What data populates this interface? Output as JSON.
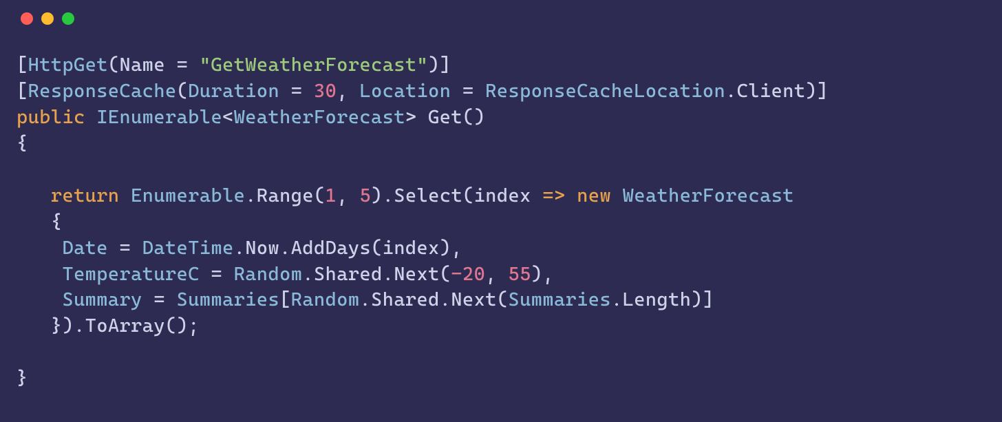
{
  "code": {
    "tokens": {
      "bracket_open": "[",
      "bracket_close": "]",
      "paren_open": "(",
      "paren_close": ")",
      "brace_open": "{",
      "brace_close": "}",
      "angle_open": "<",
      "angle_close": ">",
      "eq": "=",
      "comma": ",",
      "dot": ".",
      "semicolon": ";",
      "arrow": "=>",
      "minus": "-"
    },
    "attr_HttpGet": "HttpGet",
    "param_Name": "Name",
    "str_route": "\"GetWeatherForecast\"",
    "attr_ResponseCache": "ResponseCache",
    "param_Duration": "Duration",
    "num_30": "30",
    "param_Location": "Location",
    "ident_ResponseCacheLocation": "ResponseCacheLocation",
    "ident_Client": "Client",
    "kw_public": "public",
    "type_IEnumerable": "IEnumerable",
    "type_WeatherForecast": "WeatherForecast",
    "method_Get": "Get",
    "kw_return": "return",
    "ident_Enumerable": "Enumerable",
    "method_Range": "Range",
    "num_1": "1",
    "num_5": "5",
    "method_Select": "Select",
    "ident_index": "index",
    "kw_new": "new",
    "prop_Date": "Date",
    "ident_DateTime": "DateTime",
    "ident_Now": "Now",
    "method_AddDays": "AddDays",
    "prop_TemperatureC": "TemperatureC",
    "ident_Random": "Random",
    "ident_Shared": "Shared",
    "method_Next": "Next",
    "num_20": "20",
    "num_55": "55",
    "prop_Summary": "Summary",
    "ident_Summaries": "Summaries",
    "ident_Length": "Length",
    "method_ToArray": "ToArray"
  }
}
